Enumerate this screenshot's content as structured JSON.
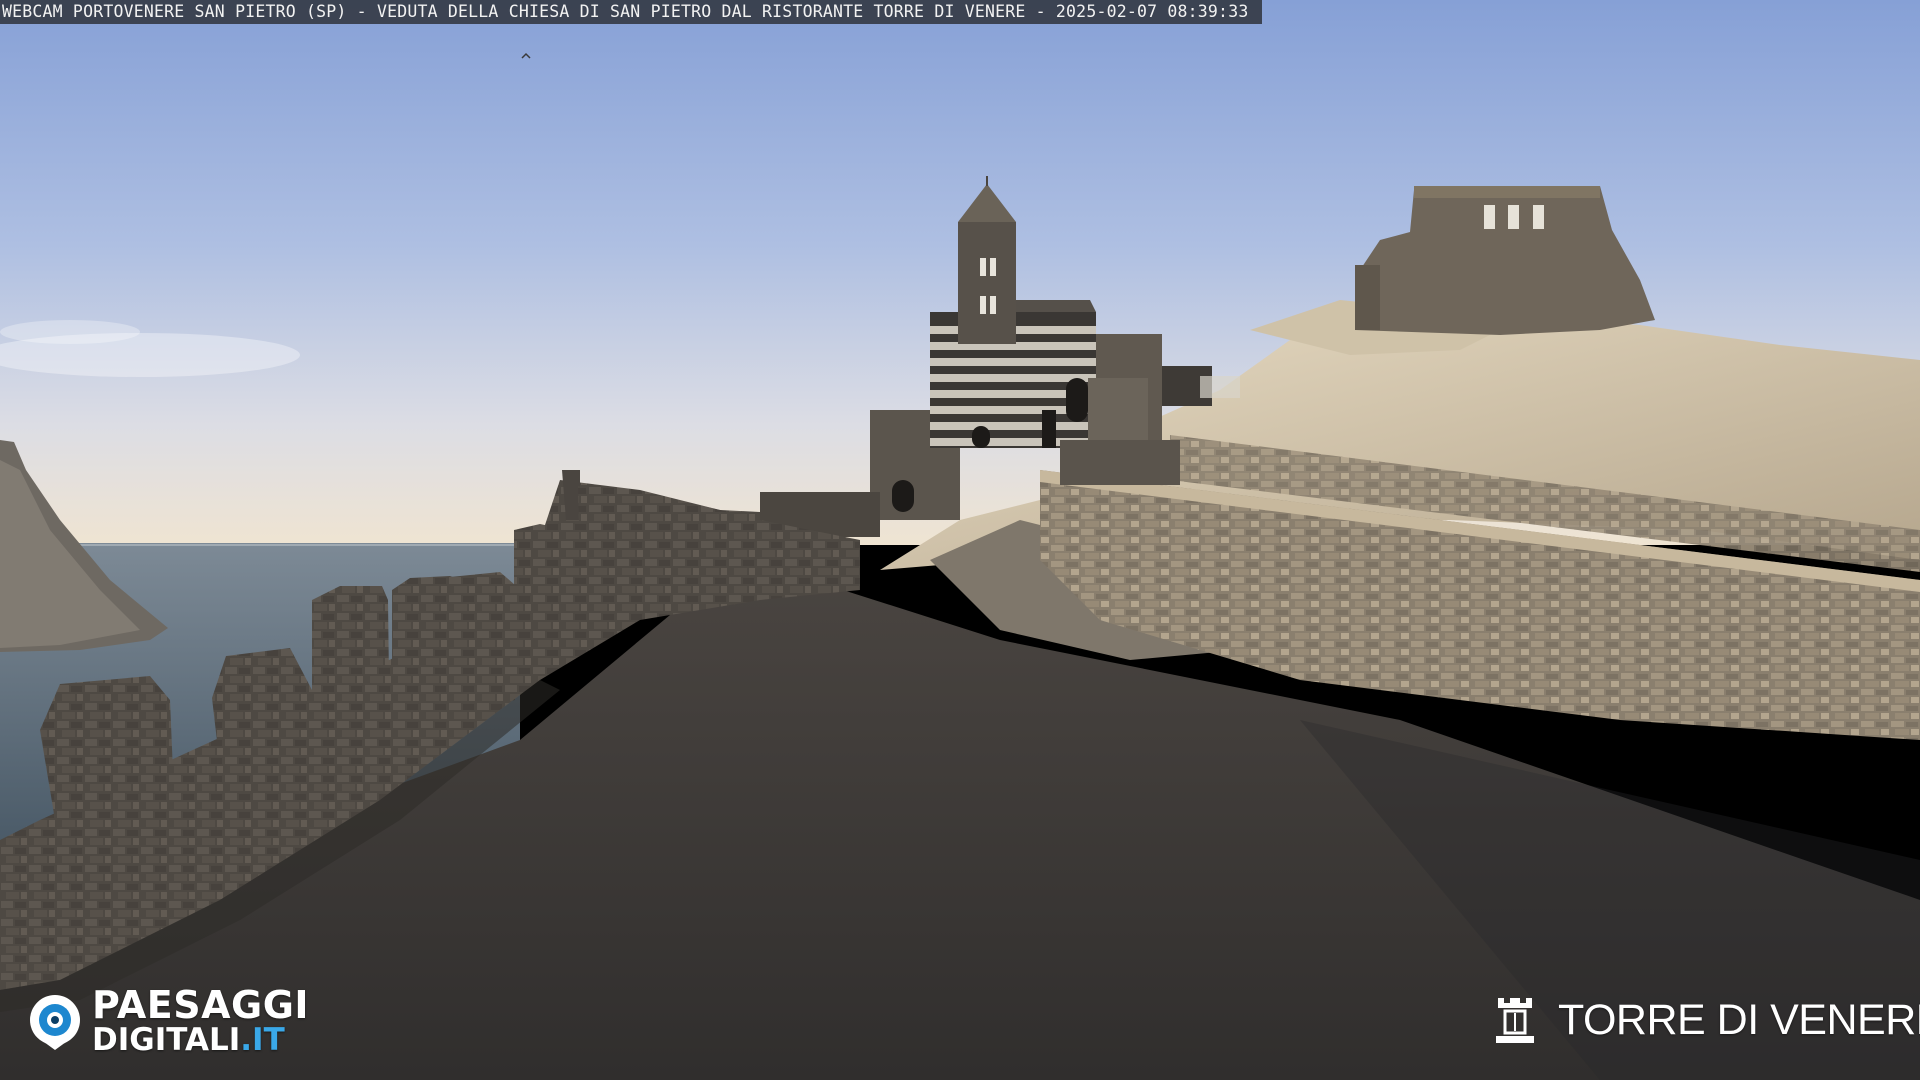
{
  "overlay": {
    "caption": "WEBCAM PORTOVENERE SAN PIETRO (SP) - VEDUTA DELLA CHIESA DI SAN PIETRO DAL RISTORANTE TORRE DI VENERE - 2025-02-07 08:39:33"
  },
  "logos": {
    "left": {
      "icon": "eye-icon",
      "line1": "PAESAGGI",
      "line2": "DIGITALI",
      "line2_suffix": ".IT",
      "accent_color": "#3aa8e8"
    },
    "right": {
      "icon": "tower-icon",
      "name": "TORRE DI VENERE"
    }
  },
  "colors": {
    "sky_top": "#8aa4d8",
    "sky_horizon": "#e8e0d4",
    "sea": "#5a6c7a",
    "path": "#3a3836",
    "stone": "#5e5850",
    "sunlit_rock": "#d8ccb4"
  }
}
